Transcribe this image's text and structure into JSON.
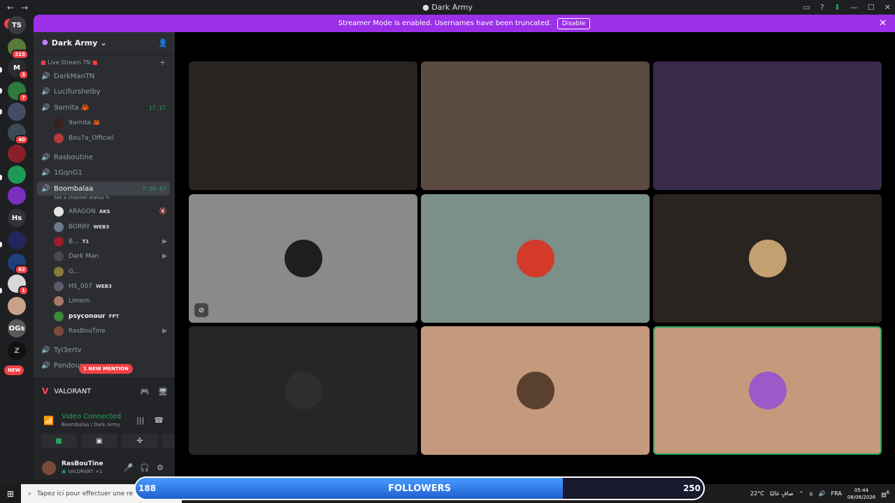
{
  "window": {
    "title": "Dark Army",
    "icons": [
      "back-arrow",
      "forward-arrow",
      "inbox",
      "help",
      "download",
      "minimize",
      "maximize",
      "close"
    ]
  },
  "rail": {
    "new_top": "NEW",
    "new_bottom": "NEW",
    "servers": [
      {
        "name": "TS",
        "label": "TS",
        "color": "#3a3c42",
        "badge": ""
      },
      {
        "name": "server-2",
        "label": "",
        "color": "#5a7a3a",
        "badge": "315"
      },
      {
        "name": "server-3",
        "label": "M",
        "color": "#2b2d31",
        "badge": "3"
      },
      {
        "name": "server-4",
        "label": "",
        "color": "#2f7a3c",
        "badge": "7"
      },
      {
        "name": "server-5",
        "label": "",
        "color": "#444c66",
        "badge": ""
      },
      {
        "name": "server-6",
        "label": "",
        "color": "#3b4a55",
        "badge": "40"
      },
      {
        "name": "server-7",
        "label": "",
        "color": "#8a1f2a",
        "badge": ""
      },
      {
        "name": "server-8",
        "label": "",
        "color": "#1f9a55",
        "badge": ""
      },
      {
        "name": "server-9",
        "label": "",
        "color": "#7a2fbf",
        "badge": ""
      },
      {
        "name": "Hs",
        "label": "Hs",
        "color": "#313338",
        "badge": ""
      },
      {
        "name": "server-11",
        "label": "",
        "color": "#22265a",
        "badge": ""
      },
      {
        "name": "server-12",
        "label": "",
        "color": "#1f3e7a",
        "badge": "82"
      },
      {
        "name": "server-13",
        "label": "",
        "color": "#d8d8d8",
        "badge": "1"
      },
      {
        "name": "server-14",
        "label": "",
        "color": "#c9a08a",
        "badge": ""
      },
      {
        "name": "OGs",
        "label": "OGs",
        "color": "#5a5a5a",
        "badge": ""
      },
      {
        "name": "server-16",
        "label": "ℤ",
        "color": "#111111",
        "badge": ""
      }
    ]
  },
  "banner": {
    "text": "Streamer Mode is enabled. Usernames have been truncated.",
    "button": "Disable"
  },
  "guild": {
    "name": "Dark Army",
    "category": "Live Stream",
    "category_suffix": "TN"
  },
  "channels": [
    {
      "name": "DarkManTN",
      "time": "",
      "active": false,
      "on": false
    },
    {
      "name": "Lucifurshelby",
      "time": "",
      "active": false,
      "on": false
    },
    {
      "name": "9arnita 🦀",
      "time": "17:17",
      "active": false,
      "on": true
    },
    {
      "name": "Rasboutine",
      "time": "",
      "active": false,
      "on": false
    },
    {
      "name": "1GqnG1",
      "time": "",
      "active": false,
      "on": false
    },
    {
      "name": "Boombalaa",
      "time": "7:36:47",
      "active": true,
      "on": true
    },
    {
      "name": "Tyl3ertv",
      "time": "",
      "active": false,
      "on": false
    },
    {
      "name": "Pandous",
      "time": "",
      "active": false,
      "on": false
    }
  ],
  "channel_status": "Set a channel status",
  "members_9arnita": [
    {
      "name": "9arnita 🦀",
      "color": "#3a1f1f"
    },
    {
      "name": "Bou7a_Officiel",
      "color": "#b53a3a"
    }
  ],
  "members_boombalaa": [
    {
      "name": "ARAGON",
      "tag": "AKS",
      "icons": "🔇",
      "color": "#e5e5e5",
      "bold": false
    },
    {
      "name": "BORRY",
      "tag": "WEB3",
      "icons": "",
      "color": "#6a7a8a",
      "bold": false
    },
    {
      "name": "B...",
      "tag": "T1",
      "icons": "▶",
      "color": "#9a1f2a",
      "bold": false
    },
    {
      "name": "Dark Man",
      "tag": "",
      "icons": "▶",
      "color": "#4a4a4a",
      "bold": false
    },
    {
      "name": "G...",
      "tag": "",
      "icons": "",
      "color": "#8a7a3a",
      "bold": false
    },
    {
      "name": "HS_007",
      "tag": "WEB3",
      "icons": "",
      "color": "#5a5a6a",
      "bold": false
    },
    {
      "name": "Limem",
      "tag": "",
      "icons": "",
      "color": "#a87a6a",
      "bold": false
    },
    {
      "name": "psyconour",
      "tag": "FPT",
      "icons": "",
      "color": "#3a8a3a",
      "bold": true
    },
    {
      "name": "RasBouTine",
      "tag": "",
      "icons": "▶",
      "color": "#7a4a3a",
      "bold": false
    }
  ],
  "mention": "1 NEW MENTION",
  "activity": {
    "game": "VALORANT"
  },
  "voice": {
    "status": "Video Connected",
    "sub": "Boombalaa / Dark Army"
  },
  "user": {
    "name": "RasBouTine",
    "activity": "VALORANT +1"
  },
  "tiles": [
    {
      "name": "tile-1",
      "bg": "#2a2422",
      "avatar": "",
      "speaking": false,
      "muted": false
    },
    {
      "name": "tile-2",
      "bg": "#5a4a40",
      "avatar": "",
      "speaking": false,
      "muted": false
    },
    {
      "name": "tile-3",
      "bg": "#3a2a4a",
      "avatar": "",
      "speaking": false,
      "muted": false
    },
    {
      "name": "tile-4",
      "bg": "#8a8a8a",
      "avatar": "#1e1e1e",
      "speaking": false,
      "muted": true
    },
    {
      "name": "tile-5",
      "bg": "#7a9088",
      "avatar": "#d43a2a",
      "speaking": false,
      "muted": false
    },
    {
      "name": "tile-6",
      "bg": "#2a2420",
      "avatar": "#c4a070",
      "speaking": false,
      "muted": false
    },
    {
      "name": "tile-7",
      "bg": "#262626",
      "avatar": "#2e2e2e",
      "speaking": false,
      "muted": false
    },
    {
      "name": "tile-8",
      "bg": "#c59a7c",
      "avatar": "#5a4030",
      "speaking": false,
      "muted": false
    },
    {
      "name": "tile-9",
      "bg": "#c59a7c",
      "avatar": "#9a5ac8",
      "speaking": true,
      "muted": false
    }
  ],
  "taskbar": {
    "search": "Tapez ici pour effectuer une re",
    "temp": "22°C",
    "weather": "صافٍ غالبًا",
    "lang": "FRA",
    "time": "05:44",
    "date": "08/08/2026",
    "notif": "6"
  },
  "followers": {
    "label": "FOLLOWERS",
    "current": "188",
    "goal": "250",
    "progress": 0.752
  }
}
